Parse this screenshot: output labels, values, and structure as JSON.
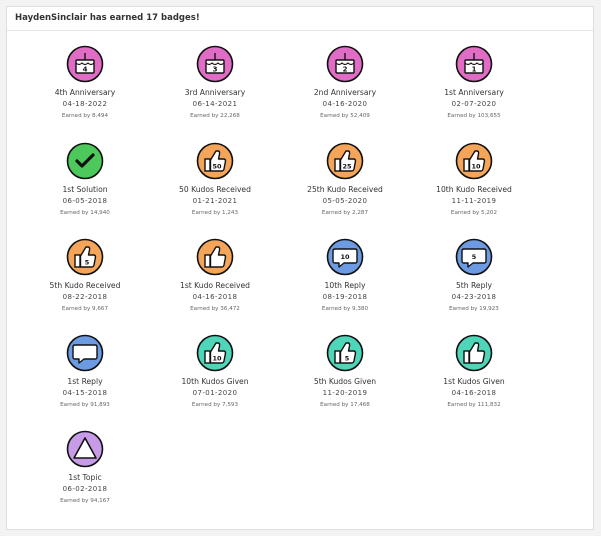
{
  "header": {
    "title": "HaydenSinclair has earned 17 badges!"
  },
  "colors": {
    "anniversary": "#e06cc5",
    "solution": "#4cc95a",
    "kudos_received": "#f5a55a",
    "reply": "#6d9be3",
    "kudos_given": "#4fd6b8",
    "topic": "#c89be8"
  },
  "badges": [
    {
      "name": "4th Anniversary",
      "date": "04-18-2022",
      "earned": "Earned by 8,494",
      "icon": "cake-icon",
      "label": "4"
    },
    {
      "name": "3rd Anniversary",
      "date": "06-14-2021",
      "earned": "Earned by 22,268",
      "icon": "cake-icon",
      "label": "3"
    },
    {
      "name": "2nd Anniversary",
      "date": "04-16-2020",
      "earned": "Earned by 52,409",
      "icon": "cake-icon",
      "label": "2"
    },
    {
      "name": "1st Anniversary",
      "date": "02-07-2020",
      "earned": "Earned by 103,655",
      "icon": "cake-icon",
      "label": "1"
    },
    {
      "name": "1st Solution",
      "date": "06-05-2018",
      "earned": "Earned by 14,940",
      "icon": "checkmark-icon",
      "label": ""
    },
    {
      "name": "50 Kudos Received",
      "date": "01-21-2021",
      "earned": "Earned by 1,243",
      "icon": "thumbs-up-icon",
      "label": "50"
    },
    {
      "name": "25th Kudo Received",
      "date": "05-05-2020",
      "earned": "Earned by 2,287",
      "icon": "thumbs-up-icon",
      "label": "25"
    },
    {
      "name": "10th Kudo Received",
      "date": "11-11-2019",
      "earned": "Earned by 5,202",
      "icon": "thumbs-up-icon",
      "label": "10"
    },
    {
      "name": "5th Kudo Received",
      "date": "08-22-2018",
      "earned": "Earned by 9,667",
      "icon": "thumbs-up-icon",
      "label": "5"
    },
    {
      "name": "1st Kudo Received",
      "date": "04-16-2018",
      "earned": "Earned by 36,472",
      "icon": "thumbs-up-icon",
      "label": ""
    },
    {
      "name": "10th Reply",
      "date": "08-19-2018",
      "earned": "Earned by 9,380",
      "icon": "speech-bubble-icon",
      "label": "10"
    },
    {
      "name": "5th Reply",
      "date": "04-23-2018",
      "earned": "Earned by 19,923",
      "icon": "speech-bubble-icon",
      "label": "5"
    },
    {
      "name": "1st Reply",
      "date": "04-15-2018",
      "earned": "Earned by 91,893",
      "icon": "speech-bubble-icon",
      "label": ""
    },
    {
      "name": "10th Kudos Given",
      "date": "07-01-2020",
      "earned": "Earned by 7,593",
      "icon": "thumbs-up-icon",
      "label": "10"
    },
    {
      "name": "5th Kudos Given",
      "date": "11-20-2019",
      "earned": "Earned by 17,468",
      "icon": "thumbs-up-icon",
      "label": "5"
    },
    {
      "name": "1st Kudos Given",
      "date": "04-16-2018",
      "earned": "Earned by 111,832",
      "icon": "thumbs-up-icon",
      "label": ""
    },
    {
      "name": "1st Topic",
      "date": "06-02-2018",
      "earned": "Earned by 94,167",
      "icon": "triangle-icon",
      "label": ""
    }
  ]
}
